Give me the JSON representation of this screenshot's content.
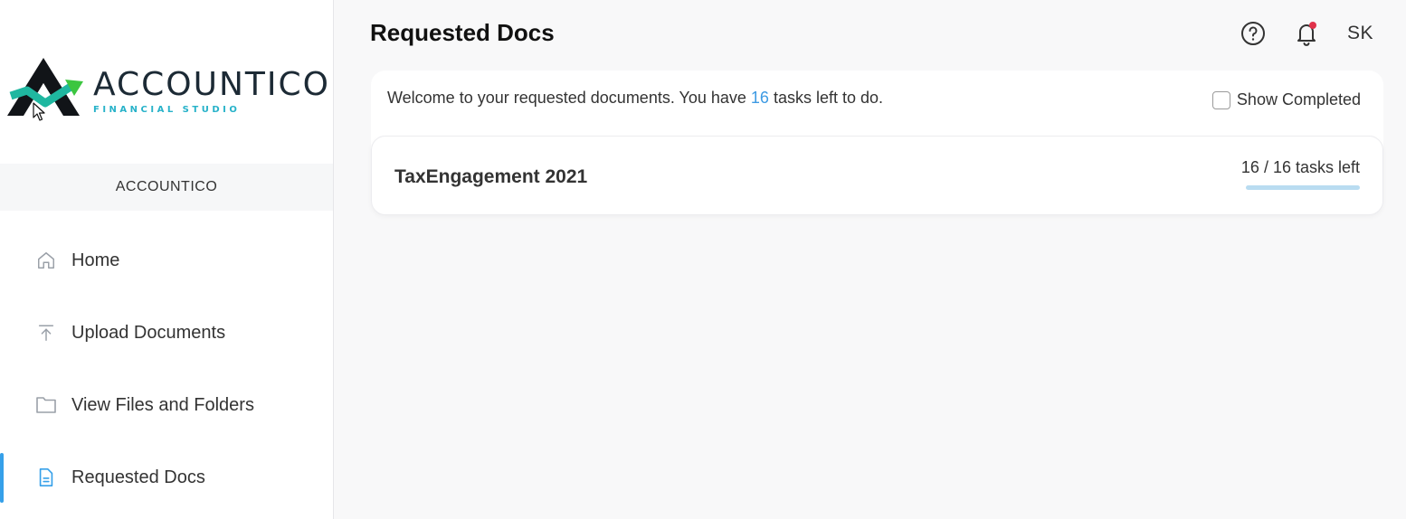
{
  "brand": {
    "title": "ACCOUNTICO",
    "subtitle": "FINANCIAL STUDIO"
  },
  "sidebar": {
    "org_name": "ACCOUNTICO",
    "items": [
      {
        "label": "Home",
        "icon": "home-icon",
        "active": false
      },
      {
        "label": "Upload Documents",
        "icon": "upload-icon",
        "active": false
      },
      {
        "label": "View Files and Folders",
        "icon": "folder-icon",
        "active": false
      },
      {
        "label": "Requested Docs",
        "icon": "document-icon",
        "active": true
      }
    ]
  },
  "header": {
    "title": "Requested Docs",
    "user_initials": "SK"
  },
  "main": {
    "welcome_prefix": "Welcome to your requested documents. You have ",
    "tasks_left": "16",
    "welcome_suffix": " tasks left to do.",
    "show_completed_label": "Show Completed",
    "show_completed_checked": false,
    "engagements": [
      {
        "title": "TaxEngagement 2021",
        "progress_text": "16 / 16 tasks left",
        "remaining_fraction": 1.0
      }
    ]
  },
  "colors": {
    "accent": "#36a0e9",
    "count_highlight": "#3d9ae3",
    "progress": "#b9dcf1",
    "notification_dot": "#e0324b"
  }
}
